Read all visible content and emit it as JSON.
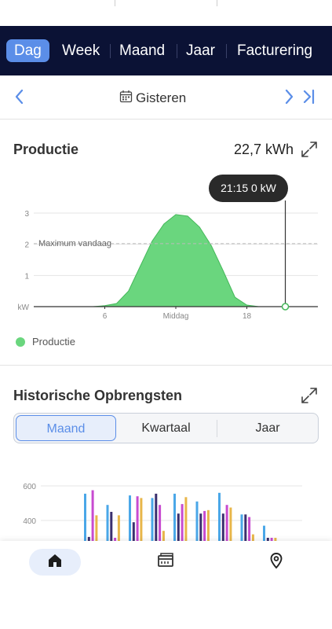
{
  "period_tabs": [
    {
      "label": "Dag",
      "active": true
    },
    {
      "label": "Week",
      "active": false
    },
    {
      "label": "Maand",
      "active": false
    },
    {
      "label": "Jaar",
      "active": false
    },
    {
      "label": "Facturering",
      "active": false
    }
  ],
  "date_nav": {
    "label": "Gisteren",
    "prev_icon": "chevron-left-icon",
    "next_icon": "chevron-right-icon",
    "last_icon": "skip-to-last-icon",
    "calendar_icon": "calendar-icon"
  },
  "production": {
    "title": "Productie",
    "total": "22,7 kWh",
    "tooltip": "21:15 0 kW",
    "max_label": "Maximum vandaag",
    "legend": "Productie"
  },
  "history": {
    "title": "Historische Opbrengsten",
    "segments": [
      {
        "label": "Maand",
        "active": true
      },
      {
        "label": "Kwartaal",
        "active": false
      },
      {
        "label": "Jaar",
        "active": false
      }
    ]
  },
  "bottom_nav": [
    {
      "icon": "home-icon",
      "active": true
    },
    {
      "icon": "dashboard-icon",
      "active": false
    },
    {
      "icon": "location-icon",
      "active": false
    }
  ],
  "colors": {
    "accent": "#5b8ee8",
    "header_bg": "#0b1235",
    "production_green": "#6ad67e"
  },
  "chart_data": [
    {
      "type": "area",
      "series": [
        {
          "name": "Productie"
        }
      ],
      "x": [
        0,
        1,
        2,
        3,
        4,
        5,
        6,
        7,
        8,
        9,
        10,
        11,
        12,
        13,
        14,
        15,
        16,
        17,
        18,
        19,
        20,
        21,
        22,
        23,
        24
      ],
      "values": [
        0,
        0,
        0,
        0,
        0,
        0,
        0.03,
        0.1,
        0.5,
        1.3,
        2.1,
        2.65,
        2.95,
        2.9,
        2.55,
        1.95,
        1.15,
        0.3,
        0.05,
        0,
        0,
        0,
        0,
        0,
        0
      ],
      "x_ticks": [
        "6",
        "Middag",
        "18"
      ],
      "y_ticks": [
        "kW",
        "1",
        "2",
        "3"
      ],
      "ylim": [
        0,
        3.2
      ],
      "max_line": 2.02,
      "cursor_x": 21.25,
      "grid": true
    },
    {
      "type": "bar",
      "y_ticks": [
        "400",
        "600"
      ],
      "series_colors": [
        "#4aa7e8",
        "#3a2f6e",
        "#c74bd0",
        "#e8b64a"
      ],
      "groups": [
        [
          555,
          305,
          575,
          430
        ],
        [
          490,
          450,
          300,
          430
        ],
        [
          545,
          390,
          540,
          530
        ],
        [
          530,
          555,
          490,
          340
        ],
        [
          555,
          440,
          495,
          535
        ],
        [
          510,
          440,
          455,
          460
        ],
        [
          560,
          440,
          490,
          475
        ],
        [
          435,
          435,
          420,
          320
        ],
        [
          370,
          300,
          300,
          300
        ]
      ],
      "grid": true
    }
  ]
}
